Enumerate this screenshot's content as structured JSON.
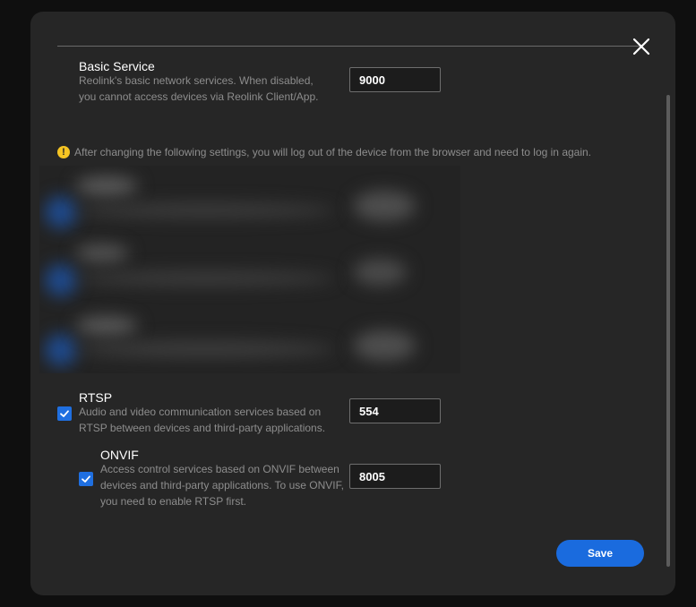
{
  "basic_service": {
    "title": "Basic Service",
    "description_line1": "Reolink's basic network services. When disabled,",
    "description_line2": "you cannot access devices via Reolink Client/App.",
    "port": "9000"
  },
  "notice": {
    "icon": "!",
    "text": "After changing the following settings, you will log out of the device from the browser and need to log in again."
  },
  "rtsp": {
    "title": "RTSP",
    "description_line1": "Audio and video communication services based on",
    "description_line2": "RTSP between devices and third-party applications.",
    "port": "554",
    "enabled": true
  },
  "onvif": {
    "title": "ONVIF",
    "description_line1": "Access control services based on ONVIF between",
    "description_line2": "devices and third-party applications. To use ONVIF,",
    "description_line3": "you need to enable RTSP first.",
    "port": "8005",
    "enabled": true
  },
  "save_label": "Save",
  "colors": {
    "accent": "#1a6bde",
    "warning": "#f5c423",
    "dialog_bg": "#262626"
  }
}
